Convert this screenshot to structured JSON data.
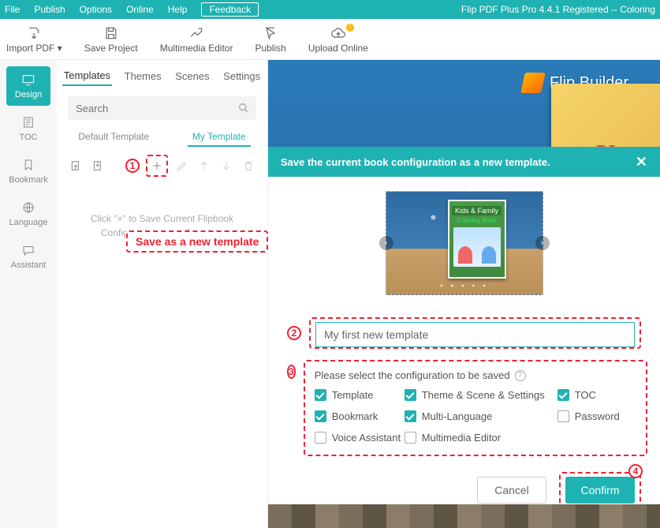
{
  "menubar": {
    "items": [
      "File",
      "Publish",
      "Options",
      "Online",
      "Help"
    ],
    "feedback": "Feedback",
    "app_title": "Flip PDF Plus Pro 4.4.1 Registered -- Coloring"
  },
  "toolbar": {
    "import": "Import PDF ▾",
    "save": "Save Project",
    "mm": "Multimedia Editor",
    "publish": "Publish",
    "upload": "Upload Online"
  },
  "rail": {
    "design": "Design",
    "toc": "TOC",
    "bookmark": "Bookmark",
    "language": "Language",
    "assistant": "Assistant"
  },
  "tabs": {
    "templates": "Templates",
    "themes": "Themes",
    "scenes": "Scenes",
    "settings": "Settings"
  },
  "search": {
    "placeholder": "Search"
  },
  "subtabs": {
    "default": "Default Template",
    "my": "My Template"
  },
  "annotations": {
    "n1": "1",
    "n2": "2",
    "n3": "3",
    "n4": "4",
    "save_new": "Save as a new template"
  },
  "hint": "Click \"+\" to Save Current Flipbook Configurations as a Template",
  "brand": "Flip Builder",
  "book_letter": "K",
  "dialog": {
    "title": "Save the current book configuration as a new template.",
    "name_value": "My first new template",
    "config_title": "Please select the configuration to be saved",
    "options": {
      "template": "Template",
      "theme": "Theme & Scene & Settings",
      "toc": "TOC",
      "bookmark": "Bookmark",
      "multi": "Multi-Language",
      "password": "Password",
      "voice": "Voice Assistant",
      "mmedit": "Multimedia Editor"
    },
    "cancel": "Cancel",
    "confirm": "Confirm"
  }
}
